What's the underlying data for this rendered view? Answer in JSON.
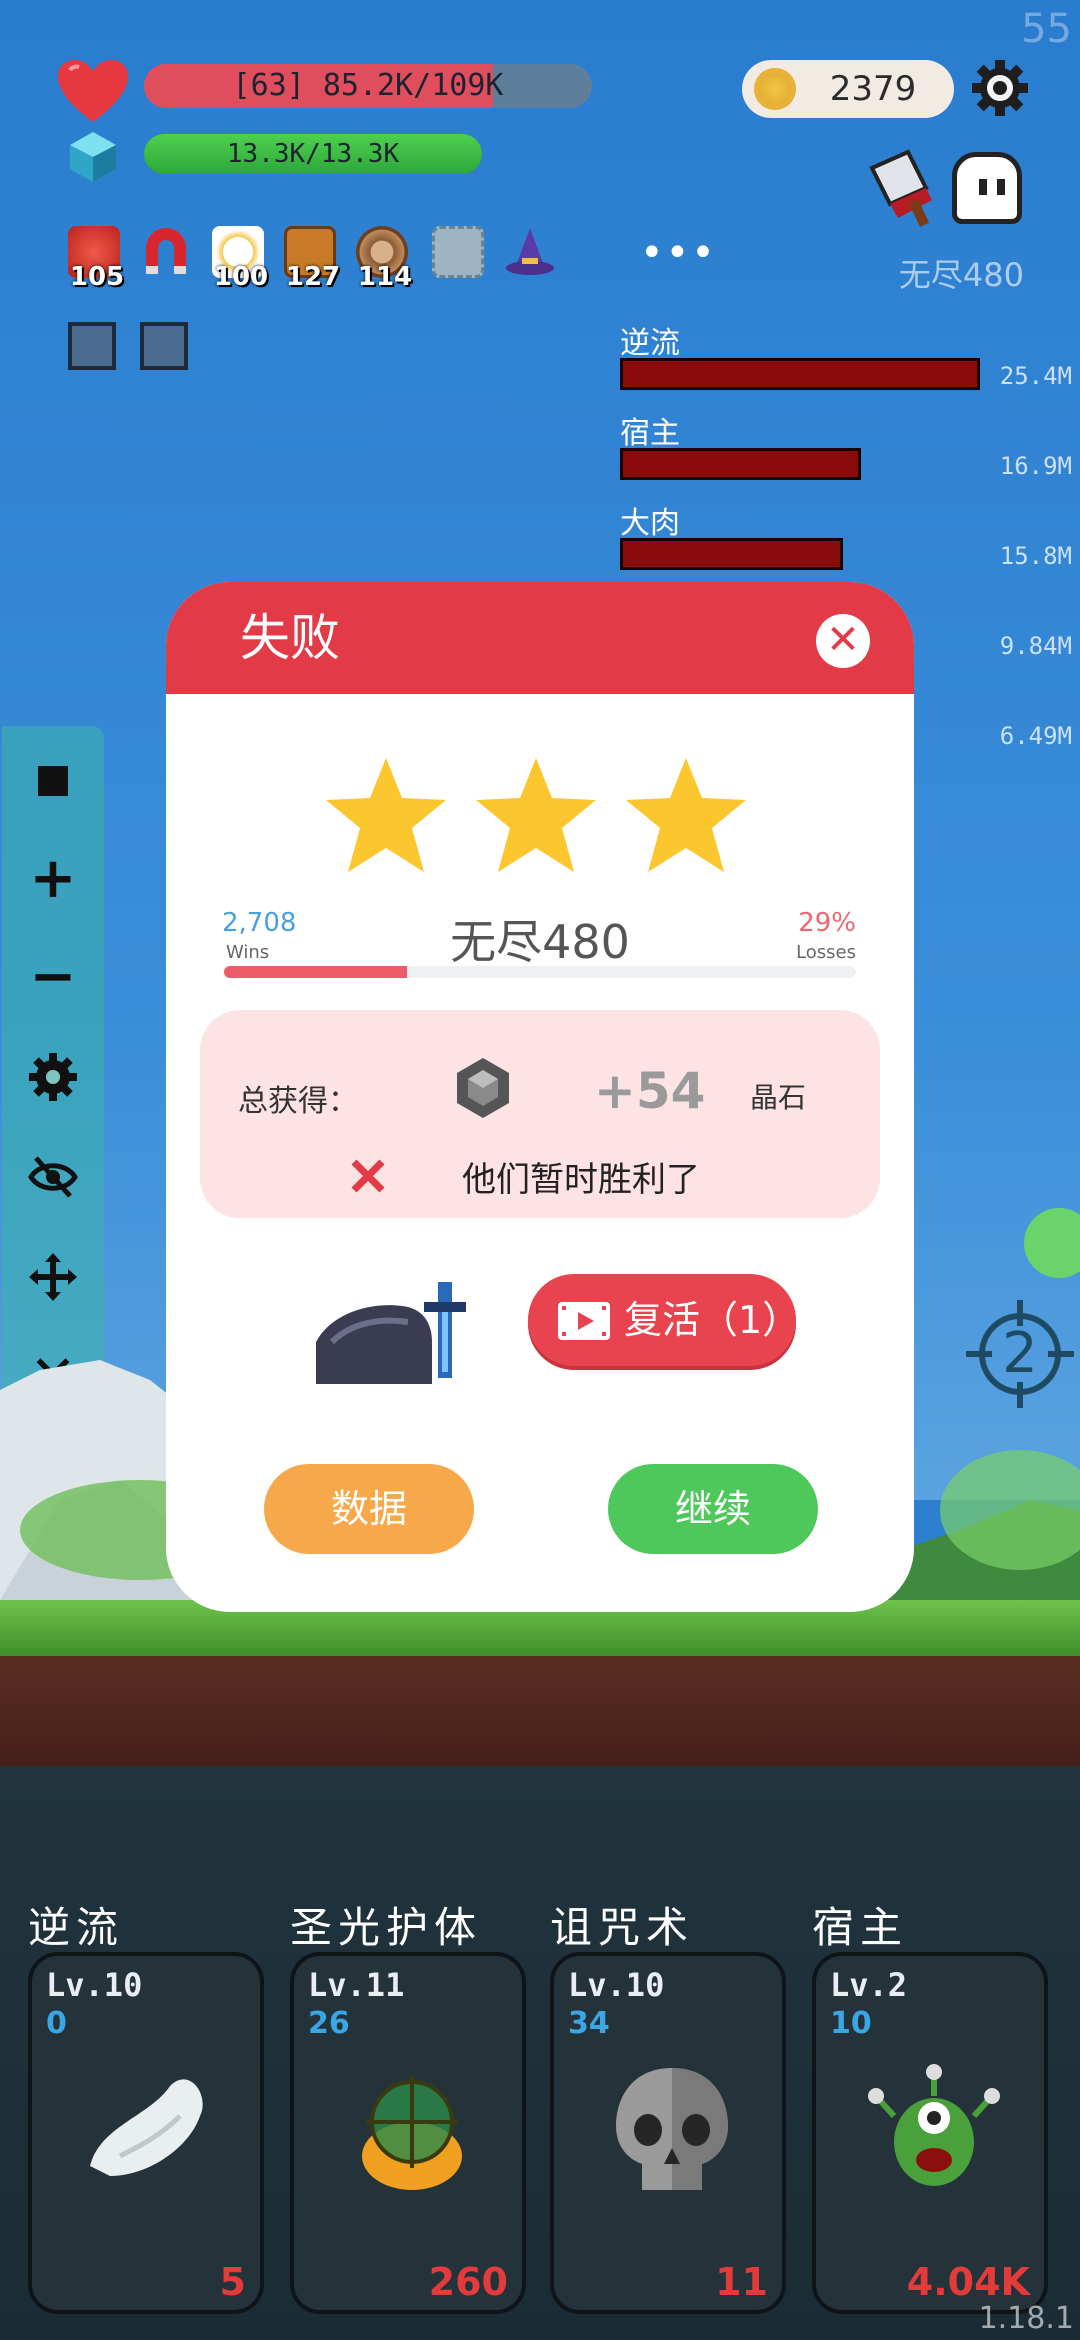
{
  "fps": "55",
  "hud": {
    "hp_text": "[63] 85.2K/109K",
    "hp_fraction": 0.78,
    "mp_text": "13.3K/13.3K",
    "mp_fraction": 1.0,
    "coins": "2379",
    "more": "•••",
    "endless_label": "无尽480"
  },
  "items": [
    {
      "icon": "apple-icon",
      "count": "105"
    },
    {
      "icon": "magnet-icon",
      "count": ""
    },
    {
      "icon": "egg-icon",
      "count": "100"
    },
    {
      "icon": "book-icon",
      "count": "127"
    },
    {
      "icon": "shield-icon",
      "count": "114"
    },
    {
      "icon": "empty-slot-icon",
      "count": ""
    },
    {
      "icon": "wizard-hat-icon",
      "count": ""
    }
  ],
  "damage": [
    {
      "name": "逆流",
      "value": "25.4M",
      "fraction": 1.0
    },
    {
      "name": "宿主",
      "value": "16.9M",
      "fraction": 0.67
    },
    {
      "name": "大肉",
      "value": "15.8M",
      "fraction": 0.62
    },
    {
      "name": "",
      "value": "9.84M"
    },
    {
      "name": "",
      "value": "6.49M"
    }
  ],
  "dialog": {
    "title": "失败",
    "close": "✕",
    "stars": 3,
    "wins_value": "2,708",
    "wins_label": "Wins",
    "stage": "无尽480",
    "losses_value": "29%",
    "losses_label": "Losses",
    "progress_fraction": 0.29,
    "reward_label": "总获得：",
    "reward_value": "+54",
    "reward_unit": "晶石",
    "result_message": "他们暂时胜利了",
    "revive_label": "复活（1）",
    "data_button": "数据",
    "continue_button": "继续"
  },
  "crosshair_number": "2",
  "skills": [
    {
      "title": "逆流",
      "level": "Lv.10",
      "sub": "0",
      "num": "5",
      "icon": "wing-icon"
    },
    {
      "title": "圣光护体",
      "level": "Lv.11",
      "sub": "26",
      "num": "260",
      "icon": "holy-shield-icon"
    },
    {
      "title": "诅咒术",
      "level": "Lv.10",
      "sub": "34",
      "num": "11",
      "icon": "skull-icon"
    },
    {
      "title": "宿主",
      "level": "Lv.2",
      "sub": "10",
      "num": "4.04K",
      "icon": "alien-icon"
    }
  ],
  "version": "1.18.1",
  "colors": {
    "accent_red": "#e23a46",
    "continue_green": "#4ec85b",
    "data_orange": "#f7a84a"
  }
}
